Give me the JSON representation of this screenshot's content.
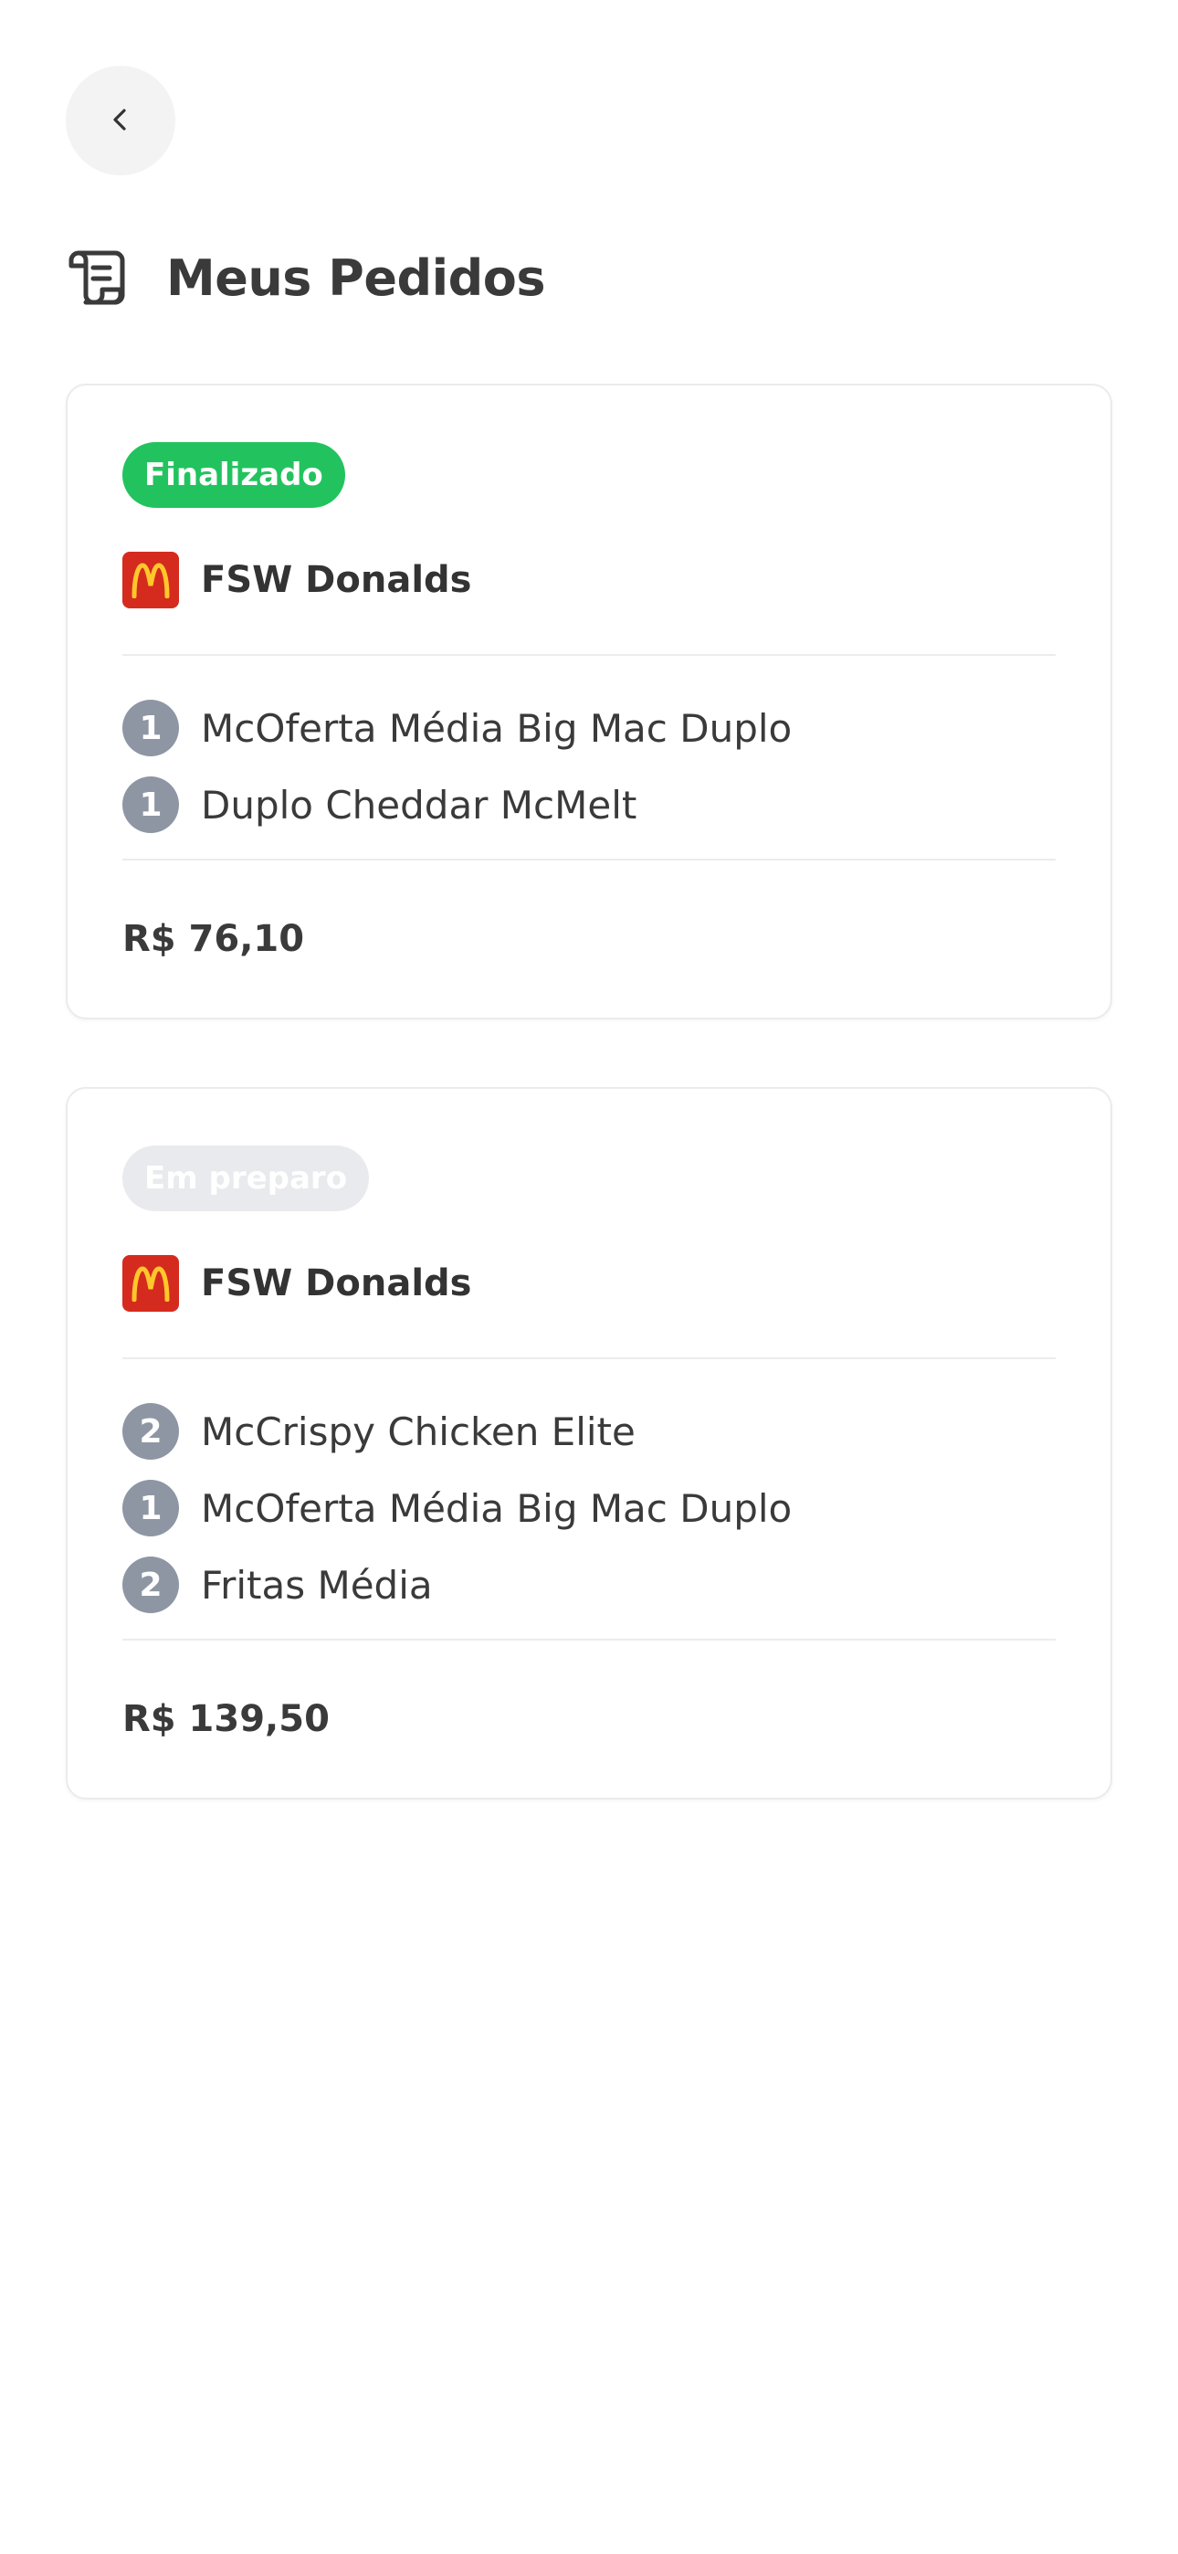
{
  "page": {
    "title": "Meus Pedidos",
    "back_icon": "chevron-left-icon",
    "title_icon": "scroll-icon"
  },
  "colors": {
    "finalizado": "#22c35e",
    "em_preparo": "#e9eaed",
    "logo_red": "#d52b1e",
    "logo_yellow": "#ffc72c",
    "qty_badge": "#8e96a4"
  },
  "orders": [
    {
      "status": "Finalizado",
      "restaurant": "FSW Donalds",
      "items": [
        {
          "qty": "1",
          "name": "McOferta Média Big Mac Duplo"
        },
        {
          "qty": "1",
          "name": "Duplo Cheddar McMelt"
        }
      ],
      "total": "R$ 76,10"
    },
    {
      "status": "Em preparo",
      "restaurant": "FSW Donalds",
      "items": [
        {
          "qty": "2",
          "name": "McCrispy Chicken Elite"
        },
        {
          "qty": "1",
          "name": "McOferta Média Big Mac Duplo"
        },
        {
          "qty": "2",
          "name": "Fritas Média"
        }
      ],
      "total": "R$ 139,50"
    }
  ]
}
